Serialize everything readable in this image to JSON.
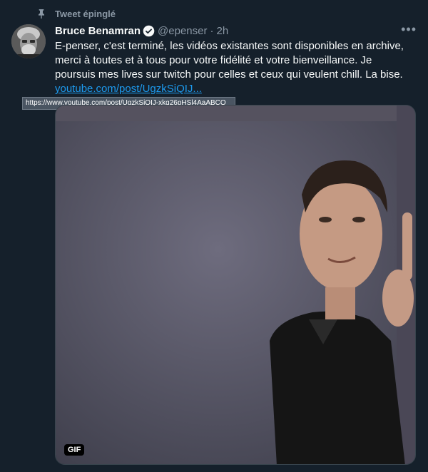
{
  "pinned": {
    "label": "Tweet épinglé",
    "icon": "pin-icon"
  },
  "author": {
    "name": "Bruce Benamran",
    "handle": "@epenser",
    "time": "2h",
    "separator": "·",
    "verified_icon": "verified-badge-icon"
  },
  "tweet": {
    "text": "E-penser, c'est terminé, les vidéos existantes sont disponibles en archive, merci à toutes et à tous pour votre fidélité et votre bienveillance. Je poursuis mes lives sur twitch pour celles et ceux qui veulent chill. La bise.",
    "link_text": "youtube.com/post/UgzkSiQIJ...",
    "link_tooltip": "https://www.youtube.com/post/UgzkSiQIJ-xkq26pHSl4AaABCQ"
  },
  "media": {
    "badge": "GIF"
  },
  "more_label": "•••",
  "colors": {
    "background": "#15202b",
    "text": "#f7f9f9",
    "muted": "#8b98a5",
    "link": "#1d9bf0",
    "verified": "#1d9bf0"
  }
}
